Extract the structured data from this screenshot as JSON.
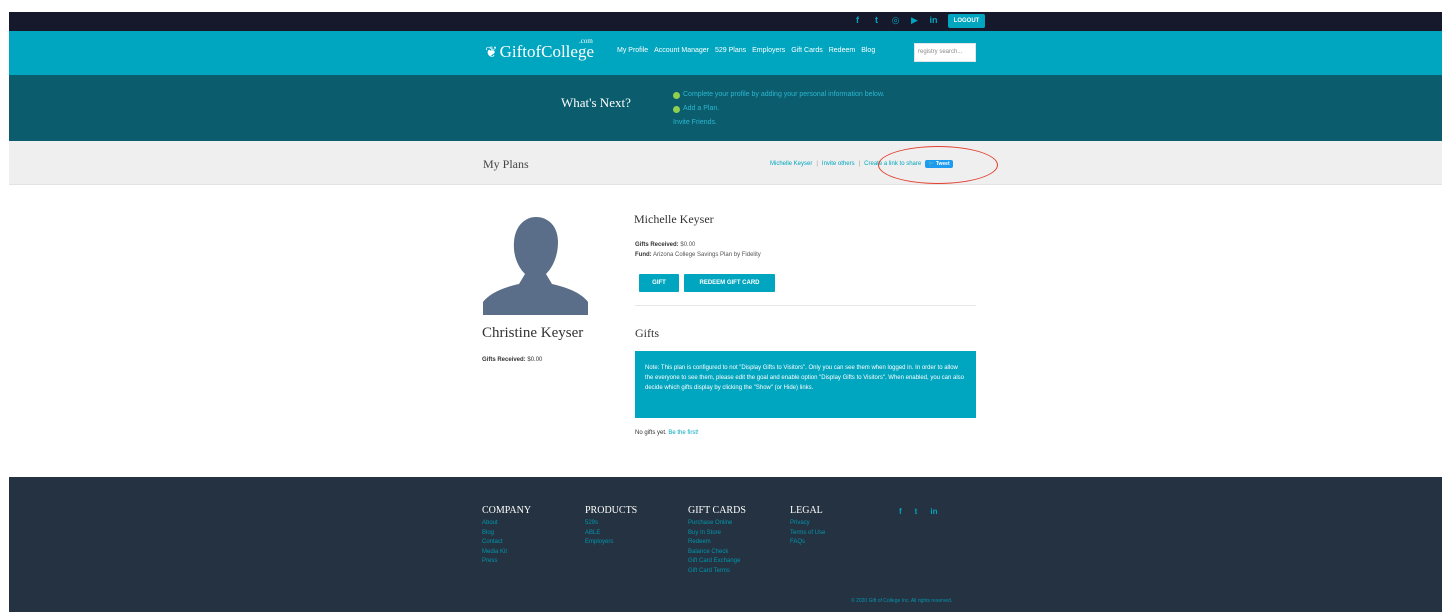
{
  "topbar": {
    "social_icons": [
      "facebook-icon",
      "twitter-icon",
      "instagram-icon",
      "youtube-icon",
      "linkedin-icon"
    ],
    "logout_label": "LOGOUT"
  },
  "nav": {
    "logo": "GiftofCollege",
    "logo_suffix": ".com",
    "links": [
      "My Profile",
      "Account Manager",
      "529 Plans",
      "Employers",
      "Gift Cards",
      "Redeem",
      "Blog"
    ],
    "search_placeholder": "registry search..."
  },
  "whats_next": {
    "title": "What's Next?",
    "items": [
      "Complete your profile by adding your personal information below.",
      "Add a Plan.",
      "Invite Friends."
    ]
  },
  "my_plans": {
    "title": "My Plans",
    "user_link": "Michelle Keyser",
    "invite_link": "Invite others",
    "share_link": "Create a link to share",
    "tweet_label": "Tweet"
  },
  "beneficiary": {
    "name": "Christine Keyser",
    "gifts_received_label": "Gifts Received:",
    "gifts_received_value": "$0.00"
  },
  "plan": {
    "owner_name": "Michelle Keyser",
    "gifts_received_label": "Gifts Received:",
    "gifts_received_value": "$0.00",
    "fund_label": "Fund:",
    "fund_value": "Arizona College Savings Plan by Fidelity",
    "gift_button": "GIFT",
    "redeem_button": "REDEEM GIFT CARD"
  },
  "gifts": {
    "title": "Gifts",
    "note": "Note: This plan is configured to not \"Display Gifts to Visitors\". Only you can see them when logged in. In order to allow the everyone to see them, please edit the goal and enable option \"Display Gifts to Visitors\". When enabled, you can also decide which gifts display by clicking the \"Show\" (or Hide) links.",
    "empty_text": "No gifts yet.",
    "empty_link": "Be the first!"
  },
  "footer": {
    "columns": [
      {
        "title": "COMPANY",
        "items": [
          "About",
          "Blog",
          "Contact",
          "Media Kit",
          "Press"
        ]
      },
      {
        "title": "PRODUCTS",
        "items": [
          "529s",
          "ABLE",
          "Employers"
        ]
      },
      {
        "title": "GIFT CARDS",
        "items": [
          "Purchase Online",
          "Buy In Store",
          "Redeem",
          "Balance Check",
          "Gift Card Exchange",
          "Gift Card Terms"
        ]
      },
      {
        "title": "LEGAL",
        "items": [
          "Privacy",
          "Terms of Use",
          "FAQs"
        ]
      }
    ],
    "social_icons": [
      "facebook-icon",
      "twitter-icon",
      "linkedin-icon"
    ],
    "copyright": "© 2020 Gift of College Inc. All rights reserved."
  },
  "colors": {
    "brand_teal": "#00a6bf",
    "dark_teal": "#0b5d6e",
    "navy": "#16192b",
    "footer": "#253241",
    "annotation_red": "#e2402f"
  }
}
